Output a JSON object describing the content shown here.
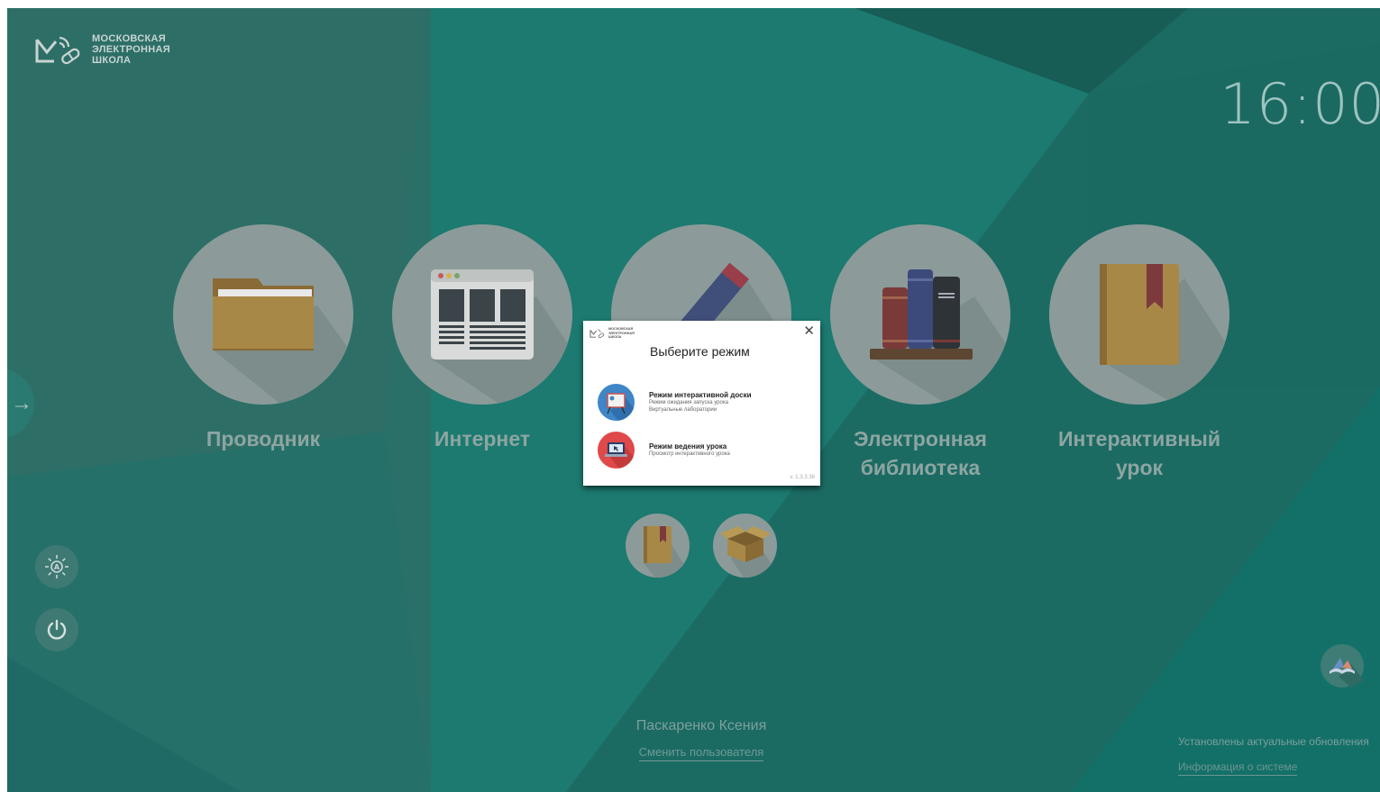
{
  "logo": {
    "lines": [
      "МОСКОВСКАЯ",
      "ЭЛЕКТРОННАЯ",
      "ШКОЛА"
    ],
    "icon": "mesh-logo-icon"
  },
  "clock": "16:00",
  "apps": [
    {
      "label_1": "Проводник",
      "label_2": "",
      "icon": "folder-icon"
    },
    {
      "label_1": "Интернет",
      "label_2": "",
      "icon": "browser-icon"
    },
    {
      "label_1": "",
      "label_2": "",
      "icon": "pencil-icon"
    },
    {
      "label_1": "Электронная",
      "label_2": "библиотека",
      "icon": "books-icon"
    },
    {
      "label_1": "Интерактивный",
      "label_2": "урок",
      "icon": "book-icon"
    }
  ],
  "small_apps": [
    {
      "icon": "bookmark-book-icon"
    },
    {
      "icon": "box-icon"
    }
  ],
  "side_panel": {
    "icon": "arrow-right-icon",
    "glyph": "→"
  },
  "controls": {
    "brightness_icon": "brightness-icon",
    "power_icon": "power-icon"
  },
  "user": {
    "name": "Паскаренко Ксения",
    "switch_label": "Сменить пользователя"
  },
  "system": {
    "status": "Установлены актуальные обновления",
    "info_label": "Информация о системе"
  },
  "library_button": {
    "icon": "open-book-icon"
  },
  "dialog": {
    "logo_lines": [
      "МОСКОВСКАЯ",
      "ЭЛЕКТРОННАЯ",
      "ШКОЛА"
    ],
    "close_glyph": "✕",
    "title": "Выберите режим",
    "modes": [
      {
        "title": "Режим интерактивной доски",
        "sub_1": "Режим ожидания запуска урока",
        "sub_2": "Виртуальные лаборатории",
        "icon": "whiteboard-icon",
        "color": "#3f86c8"
      },
      {
        "title": "Режим ведения урока",
        "sub_1": "Просмотр интерактивного урока",
        "sub_2": "",
        "icon": "laptop-icon",
        "color": "#e0494a"
      }
    ],
    "version": "v. 1.3.3.36"
  },
  "colors": {
    "background": "#1e6f67",
    "circle": "#8c9b99",
    "label": "#8ea5a1"
  }
}
